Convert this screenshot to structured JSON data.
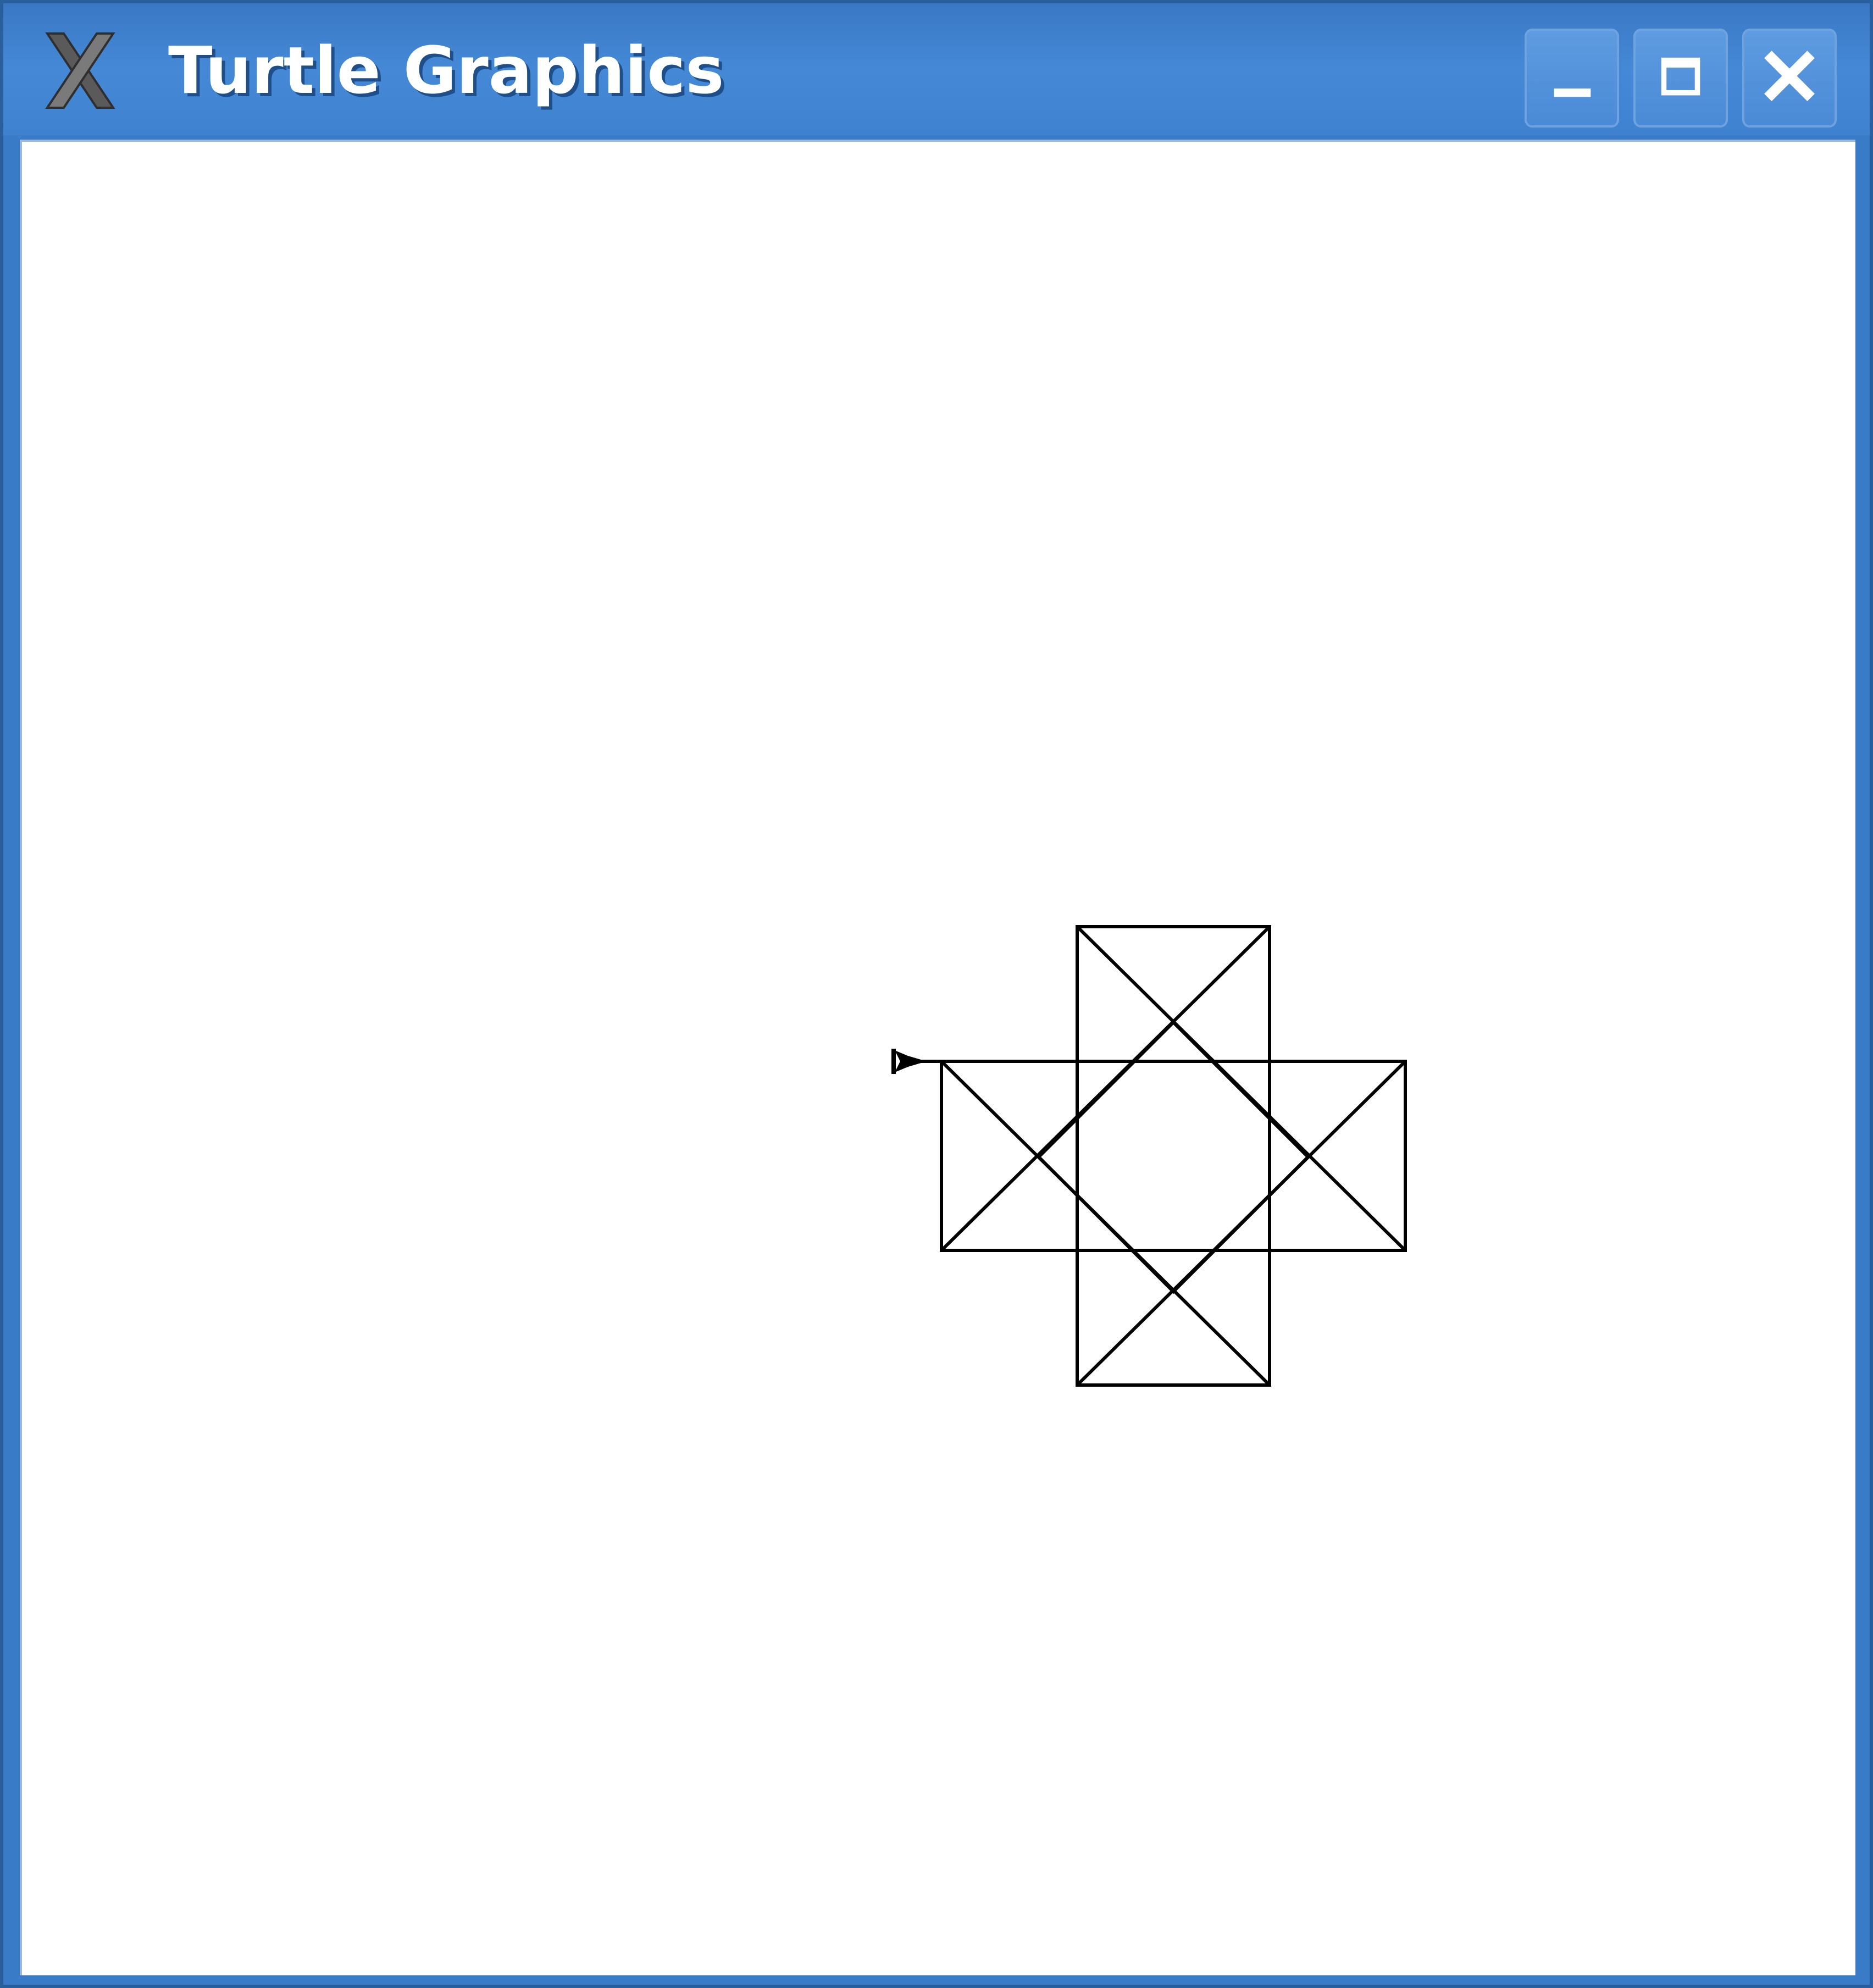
{
  "window": {
    "title": "Turtle Graphics",
    "app_icon": "x-logo-icon",
    "controls": {
      "minimize_icon": "minimize-icon",
      "maximize_icon": "maximize-icon",
      "close_icon": "close-icon"
    }
  },
  "canvas": {
    "background": "#ffffff",
    "drawing": {
      "shape": "eight-pointed star",
      "stroke_color": "#000000",
      "cursor_icon": "turtle-arrow-icon"
    }
  },
  "colors": {
    "titlebar": "#3f82d0",
    "frame": "#2a5f9e",
    "title_text": "#ffffff"
  }
}
